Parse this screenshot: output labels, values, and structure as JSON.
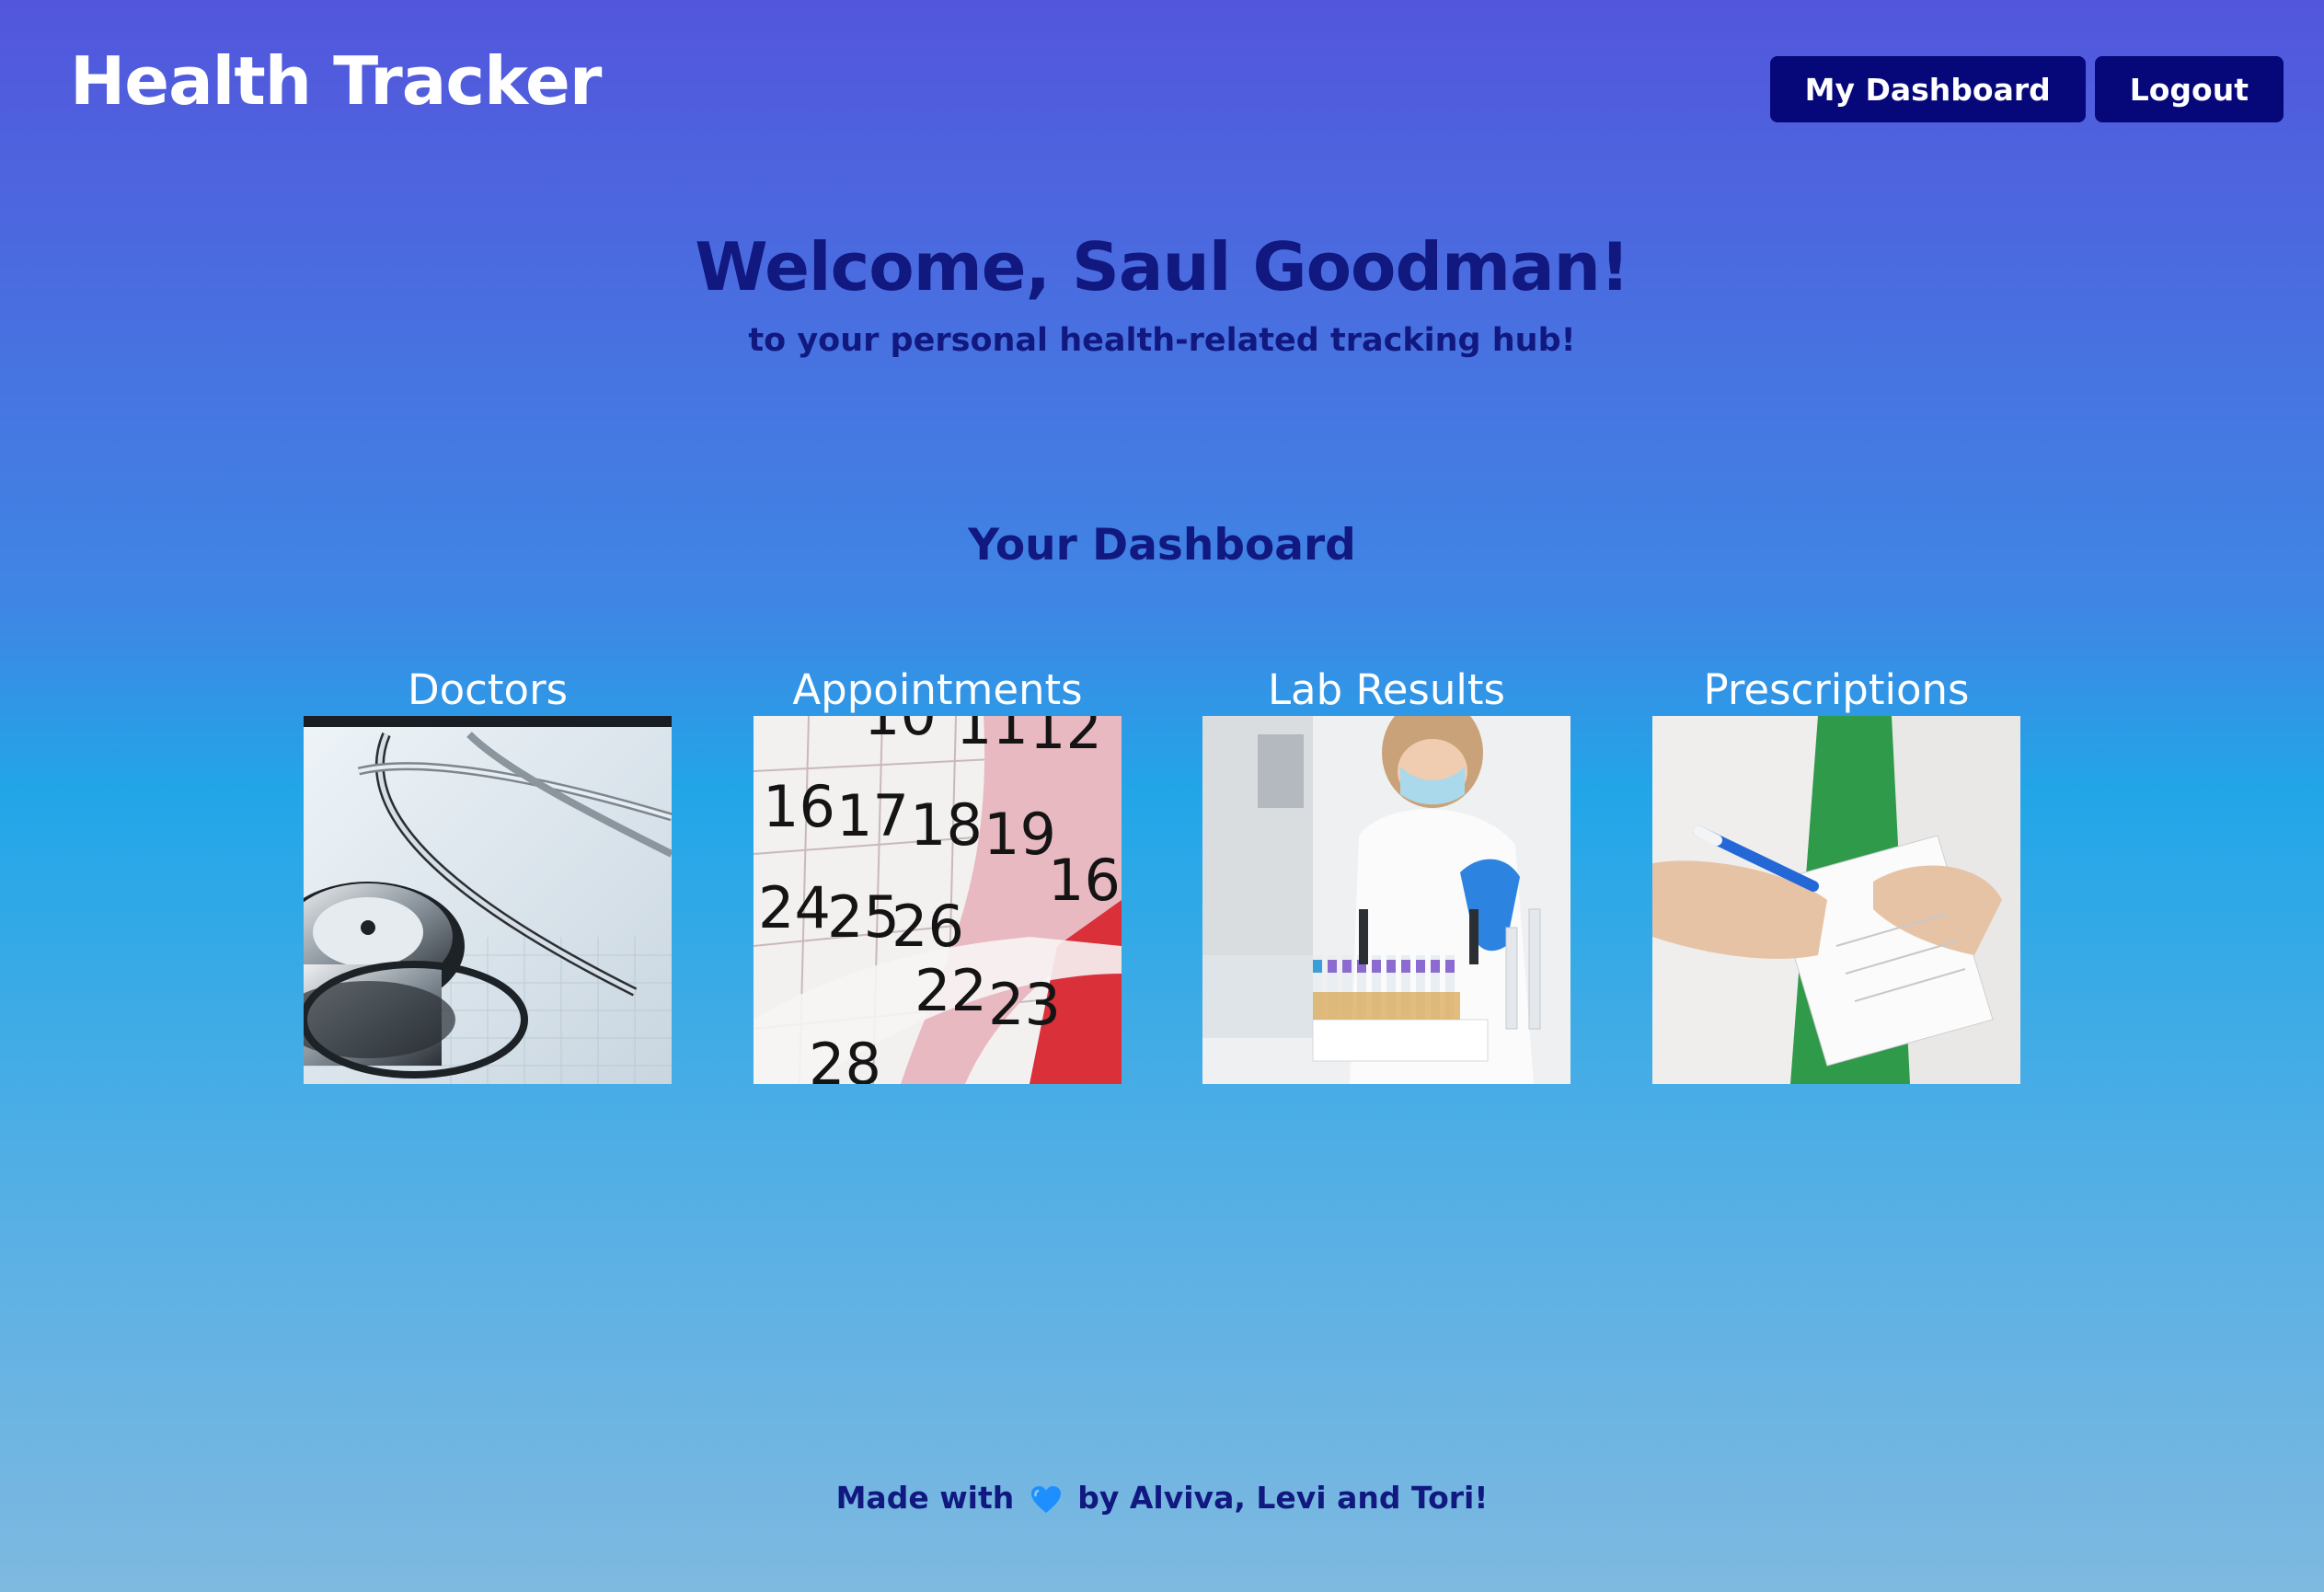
{
  "header": {
    "app_title": "Health Tracker",
    "nav": {
      "dashboard_label": "My Dashboard",
      "logout_label": "Logout"
    }
  },
  "hero": {
    "welcome": "Welcome, Saul Goodman!",
    "subtitle": "to your personal health-related tracking hub!"
  },
  "dashboard": {
    "title": "Your Dashboard",
    "cards": [
      {
        "label": "Doctors",
        "icon": "stethoscope-image"
      },
      {
        "label": "Appointments",
        "icon": "calendar-image"
      },
      {
        "label": "Lab Results",
        "icon": "lab-test-tubes-image"
      },
      {
        "label": "Prescriptions",
        "icon": "prescription-pad-image"
      }
    ]
  },
  "footer": {
    "prefix": "Made with",
    "heart": "blue-heart-icon",
    "suffix": "by Alviva, Levi and Tori!"
  },
  "colors": {
    "heading": "#111880",
    "button_bg": "#06087A",
    "gradient_top": "#5356DC",
    "gradient_mid": "#22A6E8",
    "gradient_bottom": "#7EB9E0"
  }
}
